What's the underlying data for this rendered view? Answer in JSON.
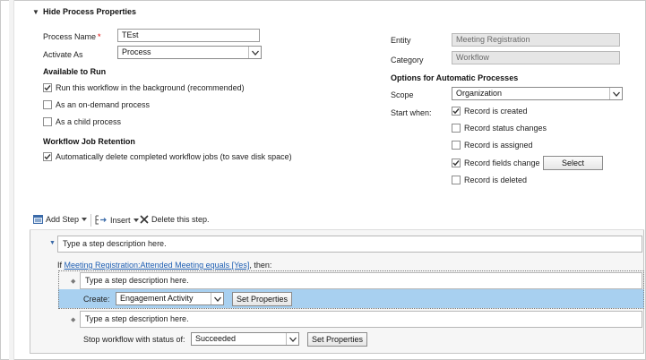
{
  "section": {
    "toggle_glyph": "▼",
    "title": "Hide Process Properties"
  },
  "process": {
    "name_label": "Process Name",
    "required_mark": "*",
    "name_value": "TEst",
    "activate_as_label": "Activate As",
    "activate_as_value": "Process"
  },
  "available_to_run": {
    "heading": "Available to Run",
    "options": [
      {
        "label": "Run this workflow in the background (recommended)",
        "checked": true
      },
      {
        "label": "As an on-demand process",
        "checked": false
      },
      {
        "label": "As a child process",
        "checked": false
      }
    ]
  },
  "retention": {
    "heading": "Workflow Job Retention",
    "option": {
      "label": "Automatically delete completed workflow jobs (to save disk space)",
      "checked": true
    }
  },
  "right_panel": {
    "entity_label": "Entity",
    "entity_value": "Meeting Registration",
    "category_label": "Category",
    "category_value": "Workflow",
    "auto_heading": "Options for Automatic Processes",
    "scope_label": "Scope",
    "scope_value": "Organization",
    "start_when_label": "Start when:",
    "start_options": [
      {
        "label": "Record is created",
        "checked": true
      },
      {
        "label": "Record status changes",
        "checked": false
      },
      {
        "label": "Record is assigned",
        "checked": false
      },
      {
        "label": "Record fields change",
        "checked": true
      },
      {
        "label": "Record is deleted",
        "checked": false
      }
    ],
    "select_button": "Select"
  },
  "toolbar": {
    "add_step": "Add Step",
    "insert": "Insert",
    "delete": "Delete this step."
  },
  "steps": {
    "top_placeholder": "Type a step description here.",
    "condition_prefix": "If ",
    "condition_link": "Meeting Registration:Attended Meeting equals [Yes]",
    "condition_suffix": ", then:",
    "inner_placeholder": "Type a step description here.",
    "create_label": "Create:",
    "create_value": "Engagement Activity",
    "set_properties_1": "Set Properties",
    "second_placeholder": "Type a step description here.",
    "stop_label": "Stop workflow with status of:",
    "stop_value": "Succeeded",
    "set_properties_2": "Set Properties"
  },
  "colors": {
    "required": "#e00000",
    "link": "#1f5fb3",
    "selected_band": "#a8d0f0",
    "readonly_field": "#e6e6e6"
  }
}
